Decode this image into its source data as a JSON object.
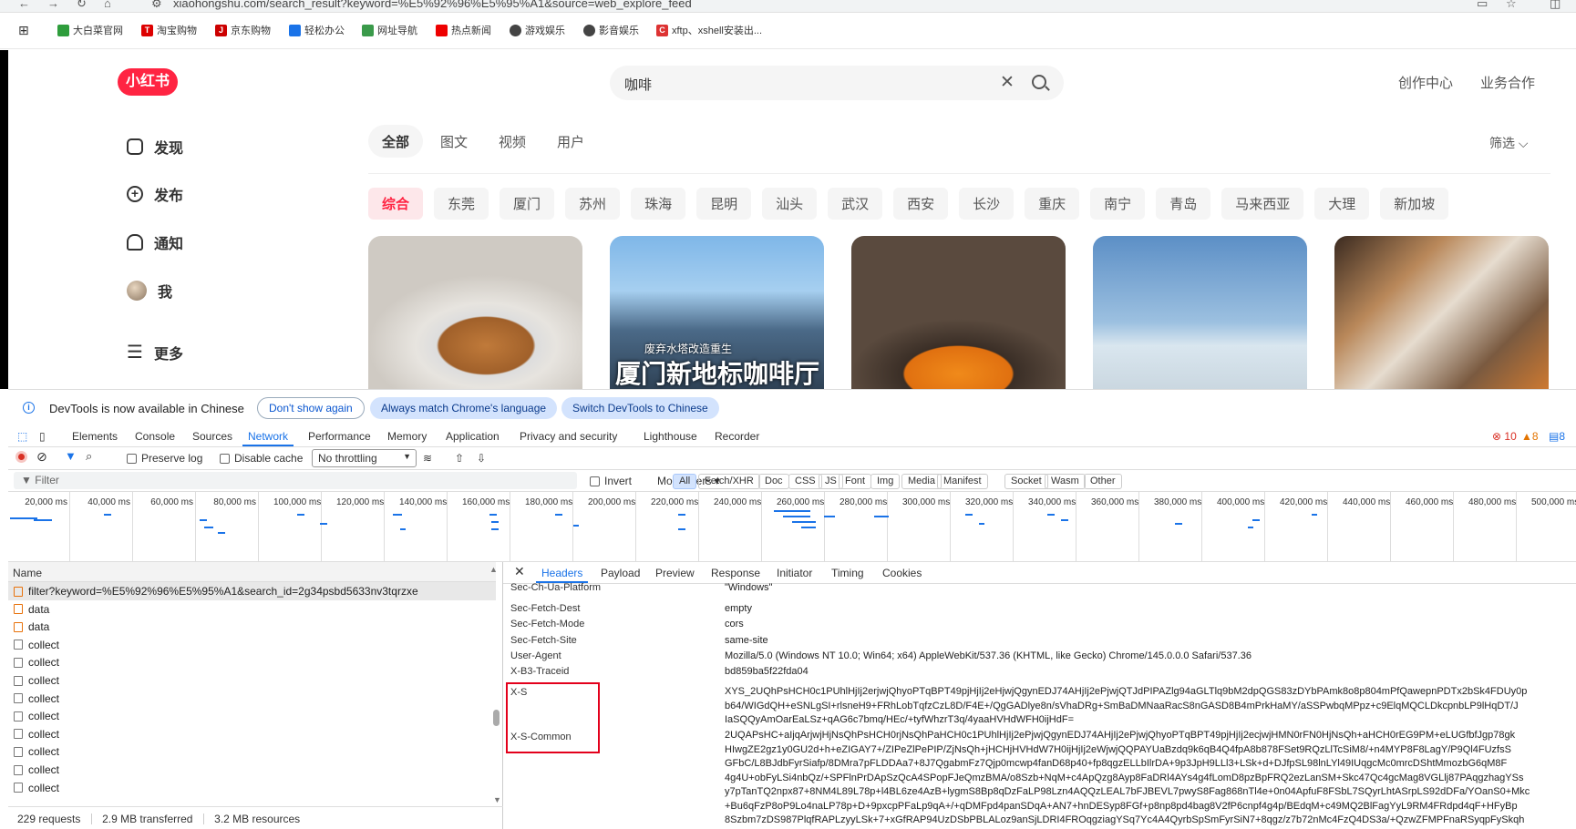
{
  "browser": {
    "url": "xiaohongshu.com/search_result?keyword=%E5%92%96%E5%95%A1&source=web_explore_feed",
    "bookmarks": [
      "大白菜官网",
      "淘宝购物",
      "京东购物",
      "轻松办公",
      "网址导航",
      "热点新闻",
      "游戏娱乐",
      "影音娱乐",
      "xftp、xshell安装出..."
    ]
  },
  "site": {
    "logo": "小红书",
    "search_query": "咖啡",
    "header_links": [
      "创作中心",
      "业务合作"
    ],
    "sidebar": [
      {
        "label": "发现",
        "icon": "home-icon"
      },
      {
        "label": "发布",
        "icon": "plus-icon"
      },
      {
        "label": "通知",
        "icon": "bell-icon"
      },
      {
        "label": "我",
        "icon": "avatar"
      },
      {
        "label": "更多",
        "icon": "menu-icon"
      }
    ],
    "tabs": [
      "全部",
      "图文",
      "视频",
      "用户"
    ],
    "filter_label": "筛选",
    "chips": [
      "综合",
      "东莞",
      "厦门",
      "苏州",
      "珠海",
      "昆明",
      "汕头",
      "武汉",
      "西安",
      "长沙",
      "重庆",
      "南宁",
      "青岛",
      "马来西亚",
      "大理",
      "新加坡"
    ],
    "card2_caption": "厦门新地标咖啡厅",
    "card2_subcaption": "废弃水塔改造重生"
  },
  "devtools": {
    "infobar_text": "DevTools is now available in Chinese",
    "infobar_buttons": [
      "Don't show again",
      "Always match Chrome's language",
      "Switch DevTools to Chinese"
    ],
    "panel_tabs": [
      "Elements",
      "Console",
      "Sources",
      "Network",
      "Performance",
      "Memory",
      "Application",
      "Privacy and security",
      "Lighthouse",
      "Recorder"
    ],
    "active_panel": "Network",
    "counts": {
      "errors": "10",
      "warnings": "8",
      "messages": "8"
    },
    "toolbar": {
      "preserve_log": "Preserve log",
      "disable_cache": "Disable cache",
      "throttling": "No throttling"
    },
    "filter": {
      "placeholder": "Filter",
      "invert": "Invert",
      "more_filters": "More filters"
    },
    "type_filters": [
      "All",
      "Fetch/XHR",
      "Doc",
      "CSS",
      "JS",
      "Font",
      "Img",
      "Media",
      "Manifest",
      "Socket",
      "Wasm",
      "Other"
    ],
    "timeline_ticks": [
      "20,000 ms",
      "40,000 ms",
      "60,000 ms",
      "80,000 ms",
      "100,000 ms",
      "120,000 ms",
      "140,000 ms",
      "160,000 ms",
      "180,000 ms",
      "200,000 ms",
      "220,000 ms",
      "240,000 ms",
      "260,000 ms",
      "280,000 ms",
      "300,000 ms",
      "320,000 ms",
      "340,000 ms",
      "360,000 ms",
      "380,000 ms",
      "400,000 ms",
      "420,000 ms",
      "440,000 ms",
      "460,000 ms",
      "480,000 ms",
      "500,000 ms"
    ],
    "name_header": "Name",
    "requests": [
      {
        "name": "filter?keyword=%E5%92%96%E5%95%A1&search_id=2g34psbd5633nv3tqrzxe",
        "type": "xhr",
        "selected": true
      },
      {
        "name": "data",
        "type": "xhr"
      },
      {
        "name": "data",
        "type": "xhr"
      },
      {
        "name": "collect",
        "type": "doc"
      },
      {
        "name": "collect",
        "type": "doc"
      },
      {
        "name": "collect",
        "type": "doc"
      },
      {
        "name": "collect",
        "type": "doc"
      },
      {
        "name": "collect",
        "type": "doc"
      },
      {
        "name": "collect",
        "type": "doc"
      },
      {
        "name": "collect",
        "type": "doc"
      },
      {
        "name": "collect",
        "type": "doc"
      },
      {
        "name": "collect",
        "type": "doc"
      }
    ],
    "status": {
      "requests": "229 requests",
      "transferred": "2.9 MB transferred",
      "resources": "3.2 MB resources"
    },
    "detail_tabs": [
      "Headers",
      "Payload",
      "Preview",
      "Response",
      "Initiator",
      "Timing",
      "Cookies"
    ],
    "headers": [
      {
        "key": "Sec-Ch-Ua-Platform",
        "value": "\"Windows\""
      },
      {
        "key": "Sec-Fetch-Dest",
        "value": "empty"
      },
      {
        "key": "Sec-Fetch-Mode",
        "value": "cors"
      },
      {
        "key": "Sec-Fetch-Site",
        "value": "same-site"
      },
      {
        "key": "User-Agent",
        "value": "Mozilla/5.0 (Windows NT 10.0; Win64; x64) AppleWebKit/537.36 (KHTML, like Gecko) Chrome/145.0.0.0 Safari/537.36"
      },
      {
        "key": "X-B3-Traceid",
        "value": "bd859ba5f22fda04"
      }
    ],
    "xs_key": "X-S",
    "xs_lines": [
      "XYS_2UQhPsHCH0c1PUhlHjIj2erjwjQhyoPTqBPT49pjHjIj2eHjwjQgynEDJ74AHjIj2ePjwjQTJdPIPAZlg94aGLTlq9bM2dpQGS83zDYbPAmk8o8p804mPfQawepnPDTx2bSk4FDUy0p",
      "b64/WIGdQH+eSNLgSI+rlsneH9+FRhLobTqfzCzL8D/F4E+/QgGADlye8n/sVhaDRg+SmBaDMNaaRacS8nGASD8B4mPrkHaMY/aSSPwbqMPpz+c9ElqMQCLDkcpnbLP9lHqDT/J",
      "IaSQQyAmOarEaLSz+qAG6c7bmq/HEc/+tyfWhzrT3q/4yaaHVHdWFH0ijHdF="
    ],
    "xsc_key": "X-S-Common",
    "xsc_lines": [
      "2UQAPsHC+aIjqArjwjHjNsQhPsHCH0rjNsQhPaHCH0c1PUhlHjIj2ePjwjQgynEDJ74AHjIj2ePjwjQhyoPTqBPT49pjHjIj2ecjwjHMN0rFN0HjNsQh+aHCH0rEG9PM+eLUGfbfJgp78gk",
      "HIwgZE2gz1y0GU2d+h+eZIGAY7+/ZIPeZlPePIP/ZjNsQh+jHCHjHVHdW7H0ijHjIj2eWjwjQQPAYUaBzdq9k6qB4Q4fpA8b878FSet9RQzLlTcSiM8/+n4MYP8F8LagY/P9Ql4FUzfsS",
      "GFbC/L8BJdbFyrSiafp/8DMra7pFLDDAa7+8J7QgabmFz7Qjp0mcwp4fanD68p40+fp8qgzELLbIlrDA+9p3JpH9LLl3+LSk+d+DJfpSL98lnLYl49IUqgcMc0mrcDShtMmozbG6qM8F",
      "4g4U+obFyLSi4nbQz/+SPFlnPrDApSzQcA4SPopFJeQmzBMA/o8Szb+NqM+c4ApQzg8Ayp8FaDRl4AYs4g4fLomD8pzBpFRQ2ezLanSM+Skc47Qc4gcMag8VGLlj87PAqgzhagYSs",
      "y7pTanTQ2npx87+8NM4L89L78p+l4BL6ze4AzB+lygmS8Bp8qDzFaLP98Lzn4AQQzLEAL7bFJBEVL7pwyS8Fag868nTl4e+0n04ApfuF8FSbL7SQyrLhtASrpLS92dDFa/YOanS0+Mkc",
      "+Bu6qFzP8oP9Lo4naLP78p+D+9pxcpPFaLp9qA+/+qDMFpd4panSDqA+AN7+hnDESyp8FGf+p8np8pd4bag8V2fP6cnpf4g4p/BEdqM+c49MQ2BlFagYyL9RM4FRdpd4qF+HFyBp",
      "8Szbm7zDS987PlqfRAPLzyyLSk+7+xGfRAP94UzDSbPBLALoz9anSjLDRI4FROqgziagYSq7Yc4A4QyrbSpSmFyrSiN7+8qgz/z7b72nMc4FzQ4DS3a/+QzwZFMPFnaRSyqpFySkqh"
    ]
  }
}
